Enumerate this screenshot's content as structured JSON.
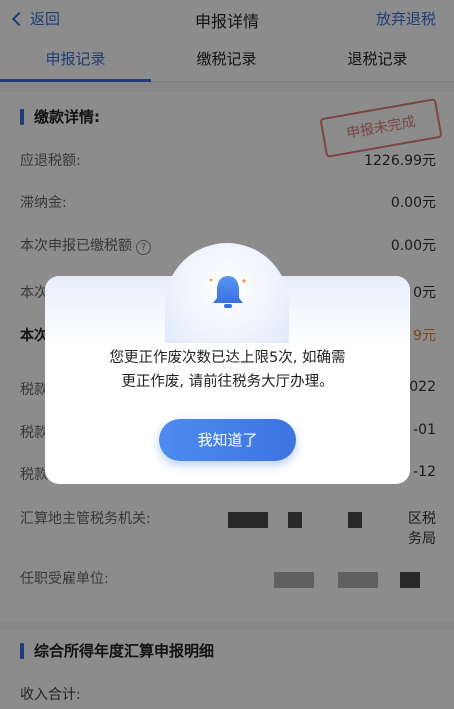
{
  "header": {
    "back_label": "返回",
    "title": "申报详情",
    "right_action": "放弃退税"
  },
  "tabs": [
    {
      "label": "申报记录",
      "active": true
    },
    {
      "label": "缴税记录",
      "active": false
    },
    {
      "label": "退税记录",
      "active": false
    }
  ],
  "payment_section": {
    "title": "缴款详情:",
    "stamp_text": "申报未完成",
    "rows": [
      {
        "label": "应退税额:",
        "value": "1226.99元"
      },
      {
        "label": "滞纳金:",
        "value": "0.00元"
      },
      {
        "label": "本次申报已缴税额",
        "value": "0.00元"
      },
      {
        "label": "本次",
        "value": "0元"
      },
      {
        "label": "本次",
        "value": "9元"
      },
      {
        "label": "税款",
        "value": "022"
      },
      {
        "label": "税款",
        "value": "-01"
      },
      {
        "label": "税款",
        "value": "-12"
      }
    ],
    "tax_authority_label": "汇算地主管税务机关:",
    "tax_authority_value_line1": "区税",
    "tax_authority_value_line2": "务局",
    "employer_label": "任职受雇单位:"
  },
  "detail_section": {
    "title": "综合所得年度汇算申报明细",
    "income_label": "收入合计:"
  },
  "modal": {
    "message_line1": "您更正作废次数已达上限5次, 如确需",
    "message_line2": "更正作废, 请前往税务大厅办理。",
    "button_label": "我知道了",
    "icon": "bell-icon"
  },
  "colors": {
    "accent": "#3a6fd8",
    "stamp": "#d9534f",
    "highlight": "#e6822b"
  }
}
